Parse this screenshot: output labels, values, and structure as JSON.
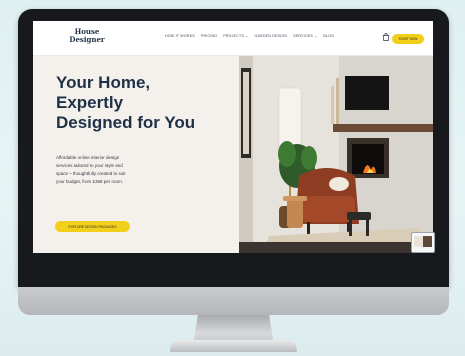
{
  "site": {
    "logo_line1": "House",
    "logo_line2": "Designer"
  },
  "nav": {
    "items": [
      "HOW IT WORKS",
      "PRICING",
      "PROJECTS ⌄",
      "GARDEN DESIGN",
      "SERVICES ⌄",
      "BLOG"
    ],
    "cart_icon": "shopping-bag-icon",
    "cta_label": "START NOW"
  },
  "hero": {
    "title_lines": [
      "Your Home,",
      "Expertly",
      "Designed for You"
    ],
    "description_lines": [
      "Affordable online interior design",
      "services tailored to your style and",
      "space – thoughtfully created to suit",
      "your budget, from £399 per room."
    ],
    "cta_label": "EXPLORE DESIGN PACKAGES"
  },
  "colors": {
    "navy": "#1f3147",
    "accent_yellow": "#f2cf1a",
    "hero_bg": "#f4f1ec"
  },
  "widgets": {
    "chat_icon": "chat-bubble-icon"
  }
}
